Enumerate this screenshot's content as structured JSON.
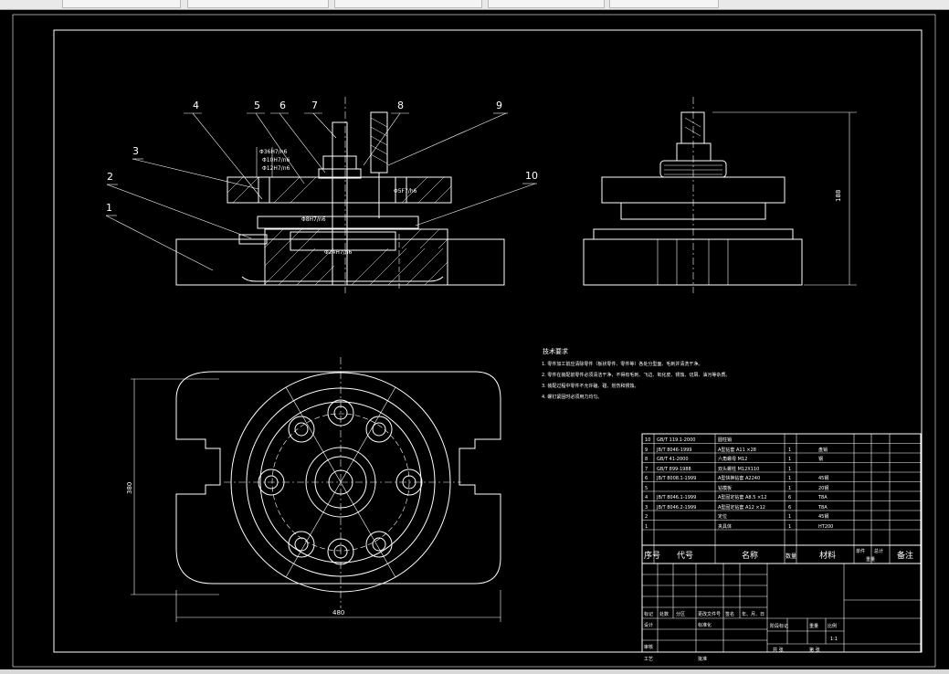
{
  "toolbar": {
    "tabs": [
      "",
      "",
      "",
      "",
      ""
    ]
  },
  "drawing": {
    "callouts": [
      "1",
      "2",
      "3",
      "4",
      "5",
      "6",
      "7",
      "8",
      "9",
      "10"
    ],
    "dims": {
      "height_right": "188",
      "width_bottom": "480",
      "height_left": "380",
      "fit1": "Φ36H7/n6",
      "fit2": "Φ24H7/n6",
      "fit3": "Φ10H7/n6",
      "fit4": "Φ12H7/n6",
      "fit5": "Φ5F7/h6",
      "fit6": "Φ8H7/n6"
    },
    "tech_title": "技术要求",
    "tech_notes": [
      "1. 零件加工前应清除零件（板状零件、零件等）各处分型面、毛刺并清洗干净。",
      "2. 零件在装配前零件必须清洁干净，不得有毛刺、飞边、氧化皮、锈蚀、切屑、油污等杂质。",
      "3. 装配过程中零件不允许磕、碰、划伤和锈蚀。",
      "4. 螺钉紧固时必须用力均匀。"
    ]
  },
  "bom": {
    "rows": [
      {
        "no": "10",
        "code": "GB/T 119.1-2000",
        "name": "圆柱销",
        "qty": "",
        "mat": ""
      },
      {
        "no": "9",
        "code": "JB/T 8046-1999",
        "name": "A型钻套 A11 ×28",
        "qty": "1",
        "mat": "盘销"
      },
      {
        "no": "8",
        "code": "GB/T 41-2000",
        "name": "六角螺母 M12",
        "qty": "1",
        "mat": "钢"
      },
      {
        "no": "7",
        "code": "GB/T 899-1988",
        "name": "双头螺柱 M12X110",
        "qty": "1",
        "mat": ""
      },
      {
        "no": "6",
        "code": "JB/T 8008.1-1999",
        "name": "A型快换钻套 A2240",
        "qty": "1",
        "mat": "45钢"
      },
      {
        "no": "5",
        "code": "",
        "name": "钻模板",
        "qty": "1",
        "mat": "20钢"
      },
      {
        "no": "4",
        "code": "JB/T 8046.1-1999",
        "name": "A型固定钻套 A8.5 ×12",
        "qty": "6",
        "mat": "T8A"
      },
      {
        "no": "3",
        "code": "JB/T 8046.2-1999",
        "name": "A型固定钻套 A12 ×12",
        "qty": "6",
        "mat": "T8A"
      },
      {
        "no": "2",
        "code": "",
        "name": "定位",
        "qty": "1",
        "mat": "45钢"
      },
      {
        "no": "1",
        "code": "",
        "name": "夹具体",
        "qty": "1",
        "mat": "HT200"
      }
    ],
    "header": {
      "no": "序号",
      "code": "代号",
      "name": "名称",
      "qty": "数量",
      "mat": "材料",
      "single": "单件",
      "total": "总计",
      "weight": "重量",
      "remark": "备注"
    },
    "title_block": {
      "mark": "标记",
      "count": "处数",
      "zone": "分区",
      "change": "更改文件号",
      "sign": "签名",
      "date": "年、月、日",
      "design": "设计",
      "std": "标准化",
      "stage": "阶段标记",
      "wt": "重量",
      "scale_label": "比例",
      "scale": "1:1",
      "review": "审核",
      "process": "工艺",
      "approve": "批准",
      "total_sheets": "共 张",
      "sheet": "第 张"
    }
  },
  "colors": {
    "background": "#000000",
    "lines": "#ffffff",
    "toolbar": "#e9e9e9"
  }
}
